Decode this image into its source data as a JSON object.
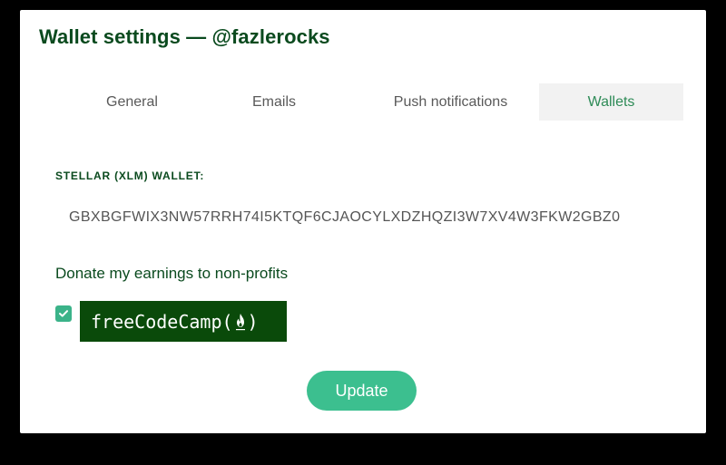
{
  "page": {
    "title": "Wallet settings — @fazlerocks"
  },
  "tabs": [
    {
      "label": "General",
      "active": false
    },
    {
      "label": "Emails",
      "active": false
    },
    {
      "label": "Push notifications",
      "active": false
    },
    {
      "label": "Wallets",
      "active": true
    }
  ],
  "wallet": {
    "label": "STELLAR (XLM) WALLET:",
    "value": "GBXBGFWIX3NW57RRH74I5KTQF6CJAOCYLXDZHQZI3W7XV4W3FKW2GBZ0"
  },
  "donate": {
    "label": "Donate my earnings to non-profits",
    "checked": true,
    "organization": {
      "name": "freeCodeCamp(",
      "suffix": ")",
      "icon": "flame-icon"
    }
  },
  "actions": {
    "update_label": "Update"
  },
  "colors": {
    "title": "#0a4a1e",
    "accent": "#3cbf8f",
    "active_tab_text": "#2e8b57",
    "active_tab_bg": "#f2f2f2",
    "logo_bg": "#0a4a0a",
    "background": "#000000"
  }
}
